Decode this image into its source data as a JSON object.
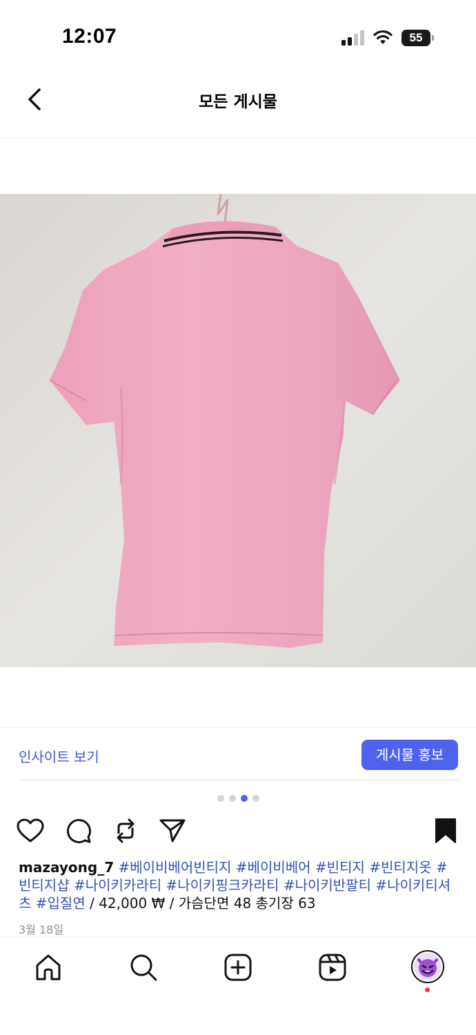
{
  "status_bar": {
    "time": "12:07",
    "battery": "55"
  },
  "header": {
    "title": "모든 게시물"
  },
  "insights": {
    "link_label": "인사이트 보기",
    "promote_label": "게시물 홍보"
  },
  "carousel": {
    "count": 4,
    "active_index": 2
  },
  "post": {
    "username": "mazayong_7",
    "hashtags": [
      "#베이비베어빈티지",
      "#베이비베어",
      "#빈티지",
      "#빈티지옷",
      "#빈티지샵",
      "#나이키카라티",
      "#나이키핑크카라티",
      "#나이키반팔티",
      "#나이키티셔츠",
      "#입질연"
    ],
    "details": "/ 42,000 ₩ / 가슴단면 48 총기장 63",
    "date": "3월 18일",
    "saved": true
  },
  "colors": {
    "accent": "#4d63ef",
    "hashtag": "#3252b5",
    "shirt": "#f1a8c2"
  },
  "icons": {
    "back": "chevron-left-icon",
    "like": "heart-icon",
    "comment": "comment-icon",
    "repost": "repost-icon",
    "share": "send-icon",
    "save": "bookmark-icon",
    "home": "home-icon",
    "search": "search-icon",
    "create": "plus-square-icon",
    "reels": "reels-icon",
    "profile": "profile-avatar"
  }
}
